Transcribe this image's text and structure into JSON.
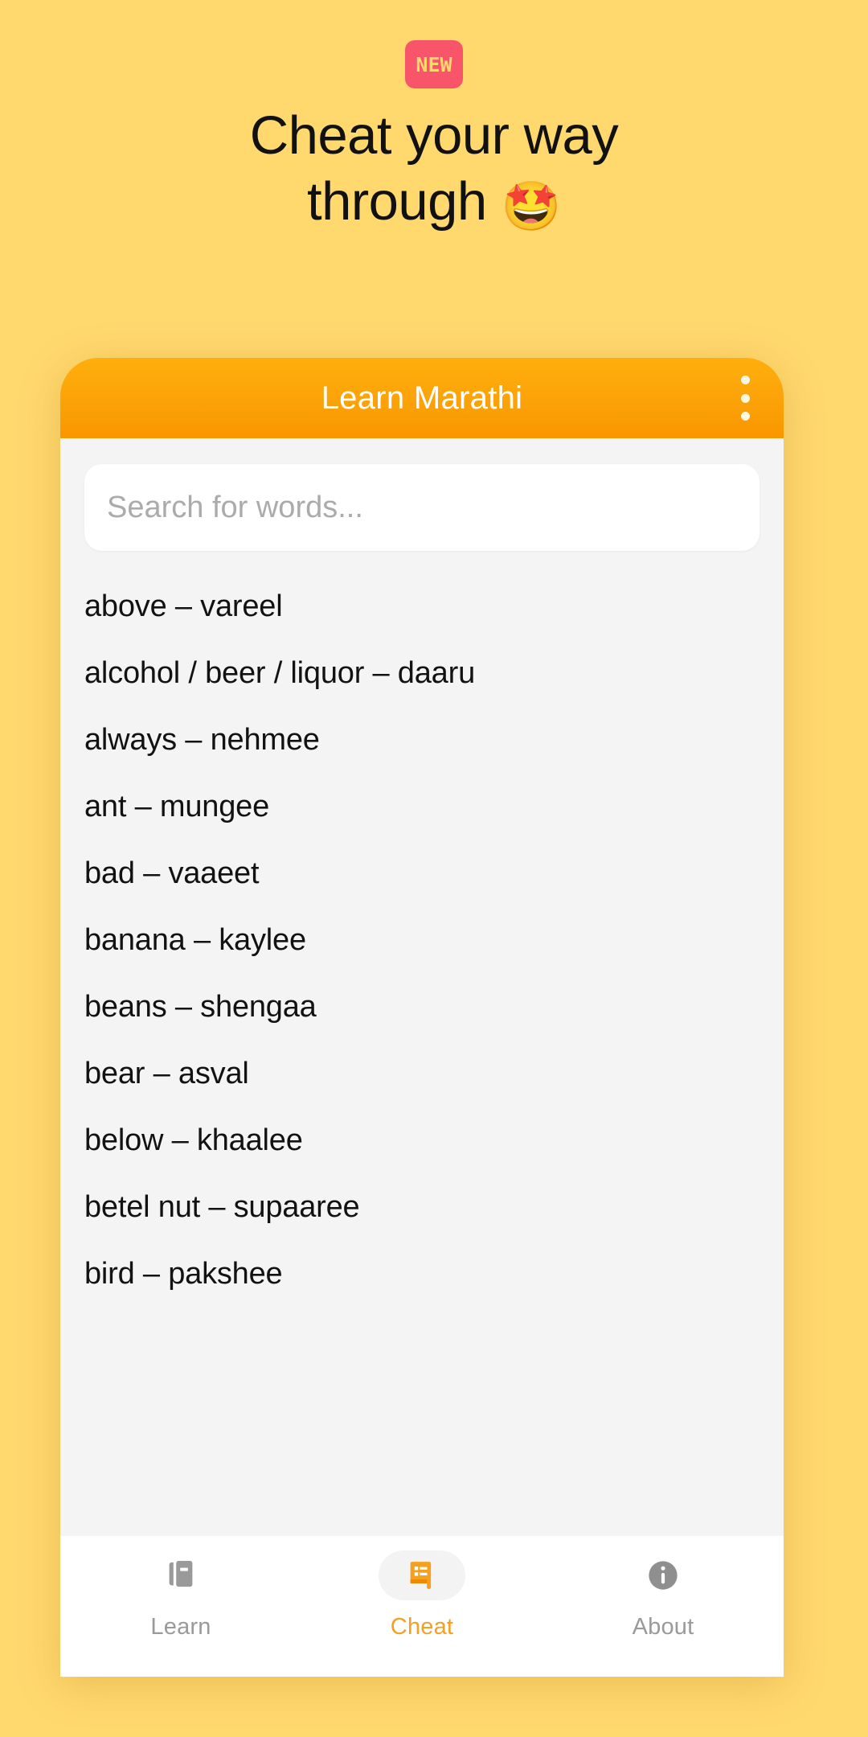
{
  "promo": {
    "badge_label": "NEW",
    "headline_line1": "Cheat your way",
    "headline_line2": "through",
    "headline_emoji": "🤩",
    "background_color": "#FFD86E",
    "badge_color": "#F9556A",
    "badge_text_color": "#FFD86E"
  },
  "app": {
    "title": "Learn Marathi",
    "appbar_color": "#FBA208",
    "menu_icon": "kebab-menu-icon"
  },
  "search": {
    "placeholder": "Search for words...",
    "value": ""
  },
  "word_list": [
    {
      "term": "above",
      "sep": "–",
      "translation": "vareel",
      "text": "above – vareel"
    },
    {
      "term": "alcohol / beer / liquor",
      "sep": "–",
      "translation": "daaru",
      "text": "alcohol / beer / liquor – daaru"
    },
    {
      "term": "always",
      "sep": "–",
      "translation": "nehmee",
      "text": "always – nehmee"
    },
    {
      "term": "ant",
      "sep": "–",
      "translation": "mungee",
      "text": "ant – mungee"
    },
    {
      "term": "bad",
      "sep": "–",
      "translation": "vaaeet",
      "text": "bad – vaaeet"
    },
    {
      "term": "banana",
      "sep": "–",
      "translation": "kaylee",
      "text": "banana – kaylee"
    },
    {
      "term": "beans",
      "sep": "–",
      "translation": "shengaa",
      "text": "beans – shengaa"
    },
    {
      "term": "bear",
      "sep": "–",
      "translation": "asval",
      "text": "bear – asval"
    },
    {
      "term": "below",
      "sep": "–",
      "translation": "khaalee",
      "text": "below – khaalee"
    },
    {
      "term": "betel nut",
      "sep": "–",
      "translation": "supaaree",
      "text": "betel nut – supaaree"
    },
    {
      "term": "bird",
      "sep": "–",
      "translation": "pakshee",
      "text": "bird – pakshee"
    }
  ],
  "bottom_nav": {
    "active_color": "#F5A01E",
    "inactive_color": "#9A9A9A",
    "items": [
      {
        "label": "Learn",
        "icon": "books-icon",
        "active": false
      },
      {
        "label": "Cheat",
        "icon": "receipt-list-icon",
        "active": true
      },
      {
        "label": "About",
        "icon": "info-circle-icon",
        "active": false
      }
    ]
  }
}
